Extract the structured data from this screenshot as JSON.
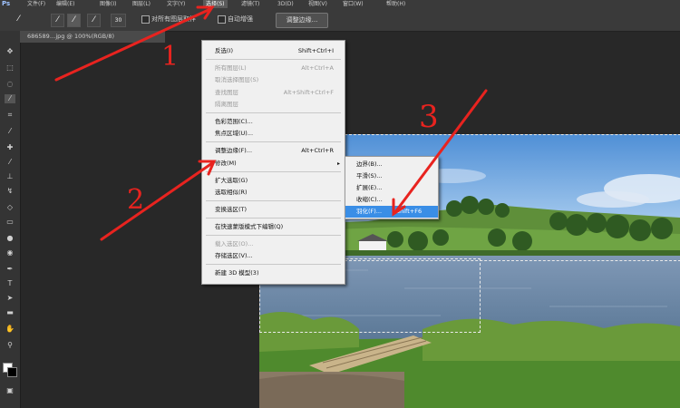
{
  "app": {
    "logo": "Ps"
  },
  "menubar": {
    "items": [
      {
        "label": "文件(F)"
      },
      {
        "label": "编辑(E)"
      },
      {
        "label": "图像(I)"
      },
      {
        "label": "图层(L)"
      },
      {
        "label": "文字(Y)"
      },
      {
        "label": "选择(S)",
        "active": true
      },
      {
        "label": "滤镜(T)"
      },
      {
        "label": "3D(D)"
      },
      {
        "label": "视图(V)"
      },
      {
        "label": "窗口(W)"
      },
      {
        "label": "帮助(H)"
      }
    ]
  },
  "options": {
    "size": "30",
    "sample_all_layers": "对所有图层取样",
    "auto_enhance": "自动增强",
    "refine_edge": "调整边缘..."
  },
  "document": {
    "tab_title": "686589…jpg @ 100%(RGB/8)"
  },
  "select_menu": {
    "items": [
      {
        "label": "反选(I)",
        "shortcut": "Shift+Ctrl+I",
        "disabled": false
      },
      {
        "label": "所有图层(L)",
        "shortcut": "Alt+Ctrl+A",
        "disabled": true
      },
      {
        "label": "取消选择图层(S)",
        "shortcut": "",
        "disabled": true
      },
      {
        "label": "查找图层",
        "shortcut": "Alt+Shift+Ctrl+F",
        "disabled": true
      },
      {
        "label": "隔离图层",
        "shortcut": "",
        "disabled": true
      },
      {
        "label": "色彩范围(C)...",
        "shortcut": "",
        "disabled": false
      },
      {
        "label": "焦点区域(U)...",
        "shortcut": "",
        "disabled": false
      },
      {
        "label": "调整边缘(F)...",
        "shortcut": "Alt+Ctrl+R",
        "disabled": false
      },
      {
        "label": "修改(M)",
        "shortcut": "",
        "disabled": false,
        "submenu": true
      },
      {
        "label": "扩大选取(G)",
        "shortcut": "",
        "disabled": false
      },
      {
        "label": "选取相似(R)",
        "shortcut": "",
        "disabled": false
      },
      {
        "label": "变换选区(T)",
        "shortcut": "",
        "disabled": false
      },
      {
        "label": "在快速蒙版模式下编辑(Q)",
        "shortcut": "",
        "disabled": false
      },
      {
        "label": "载入选区(O)...",
        "shortcut": "",
        "disabled": true
      },
      {
        "label": "存储选区(V)...",
        "shortcut": "",
        "disabled": false
      },
      {
        "label": "新建 3D 模型(3)",
        "shortcut": "",
        "disabled": false
      }
    ]
  },
  "modify_submenu": {
    "items": [
      {
        "label": "边界(B)...",
        "shortcut": "",
        "highlighted": false
      },
      {
        "label": "平滑(S)...",
        "shortcut": "",
        "highlighted": false
      },
      {
        "label": "扩展(E)...",
        "shortcut": "",
        "highlighted": false
      },
      {
        "label": "收缩(C)...",
        "shortcut": "",
        "highlighted": false
      },
      {
        "label": "羽化(F)...",
        "shortcut": "Shift+F6",
        "highlighted": true
      }
    ]
  },
  "annotations": {
    "step1": "1",
    "step2": "2",
    "step3": "3",
    "color": "#e8231f"
  },
  "colors": {
    "menu_highlight": "#3a8ee6",
    "foreground": "#ffffff",
    "background": "#000000"
  }
}
